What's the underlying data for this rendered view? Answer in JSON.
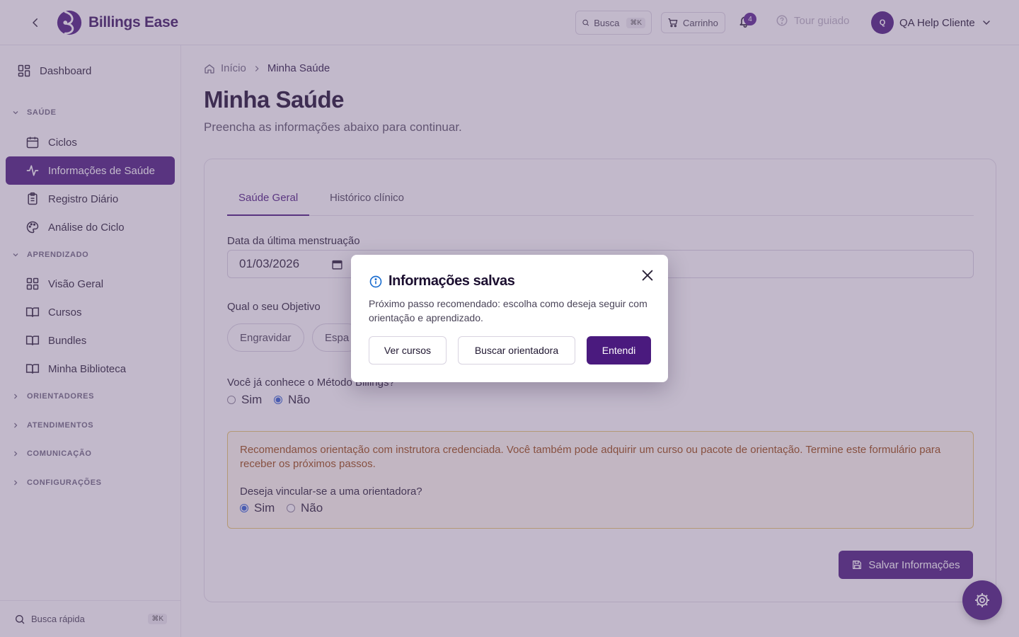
{
  "header": {
    "brand": "Billings Ease",
    "search_label": "Busca",
    "search_shortcut": "⌘K",
    "cart_label": "Carrinho",
    "notification_count": "4",
    "tour_label": "Tour guiado",
    "user_initial": "Q",
    "user_name": "QA Help Cliente"
  },
  "sidebar": {
    "dashboard": "Dashboard",
    "groups": {
      "saude": "SAÚDE",
      "aprendizado": "APRENDIZADO",
      "orientadores": "ORIENTADORES",
      "atendimentos": "ATENDIMENTOS",
      "comunicacao": "COMUNICAÇÃO",
      "configuracoes": "CONFIGURAÇÕES"
    },
    "saude_items": [
      "Ciclos",
      "Informações de Saúde",
      "Registro Diário",
      "Análise do Ciclo"
    ],
    "aprendizado_items": [
      "Visão Geral",
      "Cursos",
      "Bundles",
      "Minha Biblioteca"
    ],
    "quick_search": "Busca rápida",
    "quick_shortcut": "⌘K"
  },
  "breadcrumb": {
    "home": "Início",
    "current": "Minha Saúde"
  },
  "page": {
    "title": "Minha Saúde",
    "subtitle": "Preencha as informações abaixo para continuar."
  },
  "form": {
    "tabs": [
      "Saúde Geral",
      "Histórico clínico"
    ],
    "active_tab": "Saúde Geral",
    "last_period_label": "Data da última menstruação",
    "last_period_value": "01/03/2026",
    "goal_label": "Qual o seu Objetivo",
    "goal_options_visible": [
      "Engravidar",
      "Espa"
    ],
    "method_question": "Você já conhece o Método Billings?",
    "method_yes": "Sim",
    "method_no": "Não",
    "method_selected": "Não",
    "notice_text": "Recomendamos orientação com instrutora credenciada. Você também pode adquirir um curso ou pacote de orientação. Termine este formulário para receber os próximos passos.",
    "link_question": "Deseja vincular-se a uma orientadora?",
    "link_yes": "Sim",
    "link_no": "Não",
    "link_selected": "Sim",
    "save_label": "Salvar Informações"
  },
  "modal": {
    "title": "Informações salvas",
    "description": "Próximo passo recomendado: escolha como deseja seguir com orientação e aprendizado.",
    "btn_courses": "Ver cursos",
    "btn_find": "Buscar orientadora",
    "btn_ok": "Entendi"
  },
  "colors": {
    "primary": "#4a1a7e",
    "notice_border": "#e7c86b",
    "notice_text": "#9a4a10",
    "overlay": "rgba(110, 88, 130, 0.42)"
  }
}
